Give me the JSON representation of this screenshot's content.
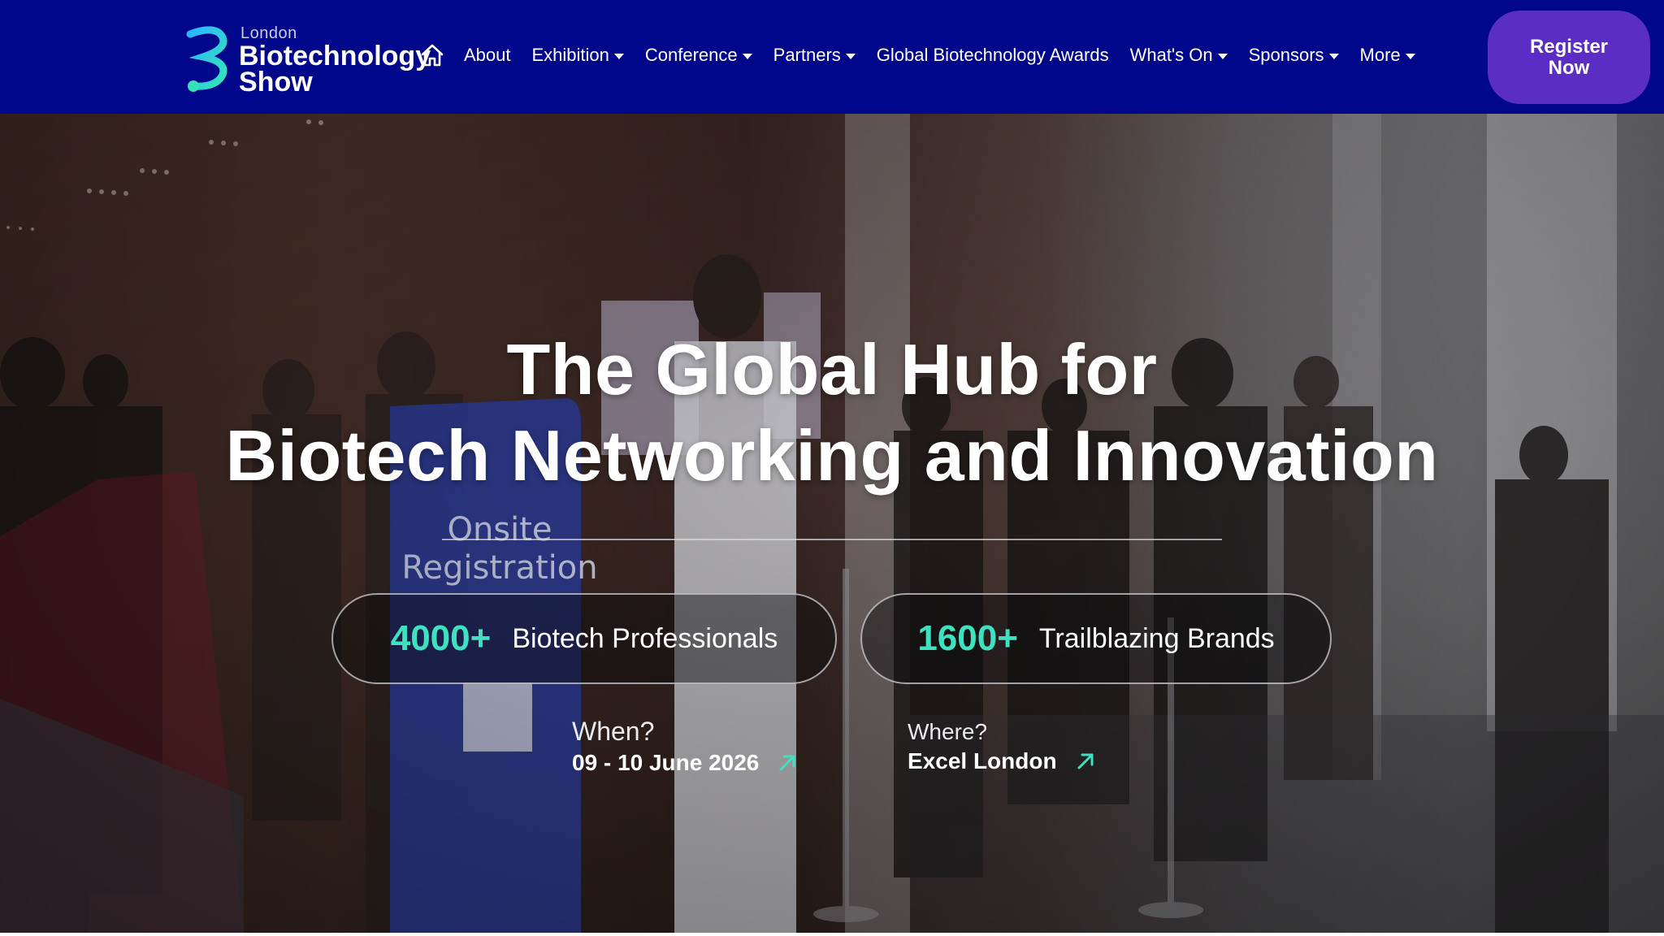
{
  "header": {
    "logo": {
      "small": "London",
      "line1": "Biotechnology",
      "line2": "Show"
    },
    "nav": [
      {
        "label": "About",
        "dropdown": false
      },
      {
        "label": "Exhibition",
        "dropdown": true
      },
      {
        "label": "Conference",
        "dropdown": true
      },
      {
        "label": "Partners",
        "dropdown": true
      },
      {
        "label": "Global Biotechnology Awards",
        "dropdown": false
      },
      {
        "label": "What's On",
        "dropdown": true
      },
      {
        "label": "Sponsors",
        "dropdown": true
      },
      {
        "label": "More",
        "dropdown": true
      }
    ],
    "register_label": "Register Now"
  },
  "hero": {
    "title_line1": "The Global Hub for",
    "title_line2": "Biotech Networking and Innovation",
    "stats": [
      {
        "number": "4000+",
        "label": "Biotech Professionals"
      },
      {
        "number": "1600+",
        "label": "Trailblazing Brands"
      }
    ],
    "when": {
      "question": "When?",
      "value": "09 - 10 June 2026"
    },
    "where": {
      "question": "Where?",
      "value": "Excel London"
    }
  },
  "colors": {
    "header_bg": "#00078a",
    "register_bg": "#5a2dc4",
    "accent_teal": "#3fe2c0"
  }
}
